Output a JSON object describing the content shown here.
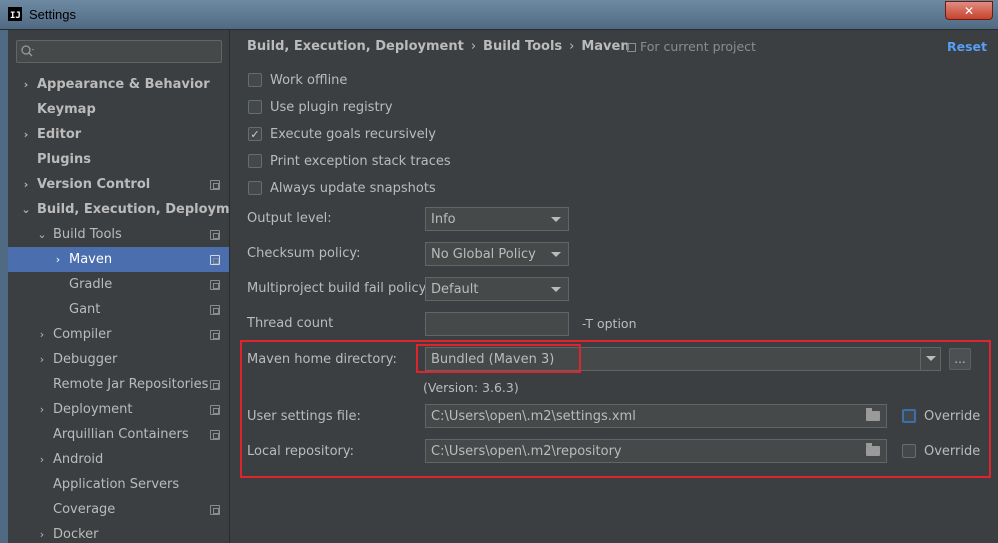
{
  "window": {
    "title": "Settings",
    "app_icon_text": "IJ",
    "close_label": "✕"
  },
  "search": {
    "placeholder": ""
  },
  "sidebar": {
    "items": [
      {
        "label": "Appearance & Behavior",
        "arrow": "›"
      },
      {
        "label": "Keymap",
        "arrow": ""
      },
      {
        "label": "Editor",
        "arrow": "›"
      },
      {
        "label": "Plugins",
        "arrow": ""
      },
      {
        "label": "Version Control",
        "arrow": "›"
      },
      {
        "label": "Build, Execution, Deployment",
        "arrow": "⌄"
      },
      {
        "label": "Build Tools",
        "arrow": "⌄"
      },
      {
        "label": "Maven",
        "arrow": "›"
      },
      {
        "label": "Gradle",
        "arrow": ""
      },
      {
        "label": "Gant",
        "arrow": ""
      },
      {
        "label": "Compiler",
        "arrow": "›"
      },
      {
        "label": "Debugger",
        "arrow": "›"
      },
      {
        "label": "Remote Jar Repositories",
        "arrow": ""
      },
      {
        "label": "Deployment",
        "arrow": "›"
      },
      {
        "label": "Arquillian Containers",
        "arrow": ""
      },
      {
        "label": "Android",
        "arrow": "›"
      },
      {
        "label": "Application Servers",
        "arrow": ""
      },
      {
        "label": "Coverage",
        "arrow": ""
      },
      {
        "label": "Docker",
        "arrow": "›"
      }
    ]
  },
  "header": {
    "crumbs": [
      "Build, Execution, Deployment",
      "Build Tools",
      "Maven"
    ],
    "separator": "›",
    "for_project": "For current project",
    "reset": "Reset"
  },
  "options": [
    {
      "label": "Work offline",
      "checked": false
    },
    {
      "label": "Use plugin registry",
      "checked": false
    },
    {
      "label": "Execute goals recursively",
      "checked": true
    },
    {
      "label": "Print exception stack traces",
      "checked": false
    },
    {
      "label": "Always update snapshots",
      "checked": false
    }
  ],
  "fields": {
    "output_level": {
      "label": "Output level:",
      "value": "Info"
    },
    "checksum": {
      "label": "Checksum policy:",
      "value": "No Global Policy"
    },
    "multiproject": {
      "label": "Multiproject build fail policy:",
      "value": "Default"
    },
    "thread_count": {
      "label": "Thread count",
      "value": "",
      "hint": "-T option"
    },
    "maven_home": {
      "label": "Maven home directory:",
      "value": "Bundled (Maven 3)",
      "dots": "..."
    },
    "version": "(Version: 3.6.3)",
    "user_settings": {
      "label": "User settings file:",
      "value": "C:\\Users\\open\\.m2\\settings.xml",
      "override": "Override"
    },
    "local_repo": {
      "label": "Local repository:",
      "value": "C:\\Users\\open\\.m2\\repository",
      "override": "Override"
    }
  },
  "colors": {
    "background": "#3c3f41",
    "selection": "#4b6eaf",
    "highlight_red": "#e0242e",
    "link": "#589df6"
  }
}
